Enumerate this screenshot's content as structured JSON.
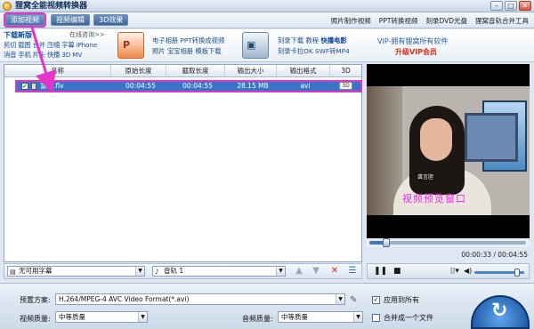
{
  "window": {
    "title": "狸窝全能视频转换器",
    "min": "–",
    "max": "□",
    "close": "✕"
  },
  "toolbar": {
    "add_video": "添加视频",
    "video_edit": "视频编辑",
    "effect_3d": "3D效果"
  },
  "top_links": [
    "照片制作视频",
    "PPT转换视频",
    "刻录DVD光盘",
    "狸窝音轨合并工具"
  ],
  "promo": {
    "download_title": "下载新版",
    "online_help": "在线咨询>>",
    "tools_line1": "剪切 截图 合并 压缩 字幕 iPhone",
    "tools_line2": "消音 手机 片头 快播 3D MV",
    "ppt_line1": "电子相册 PPT转换成视频",
    "ppt_line2": "照片 宝宝相册 模板下载",
    "burn_line1_prefix": "刻录下载 教程",
    "burn_line1_highlight": "快播电影",
    "burn_line2": "刻录卡拉OK SWF转MP4",
    "vip_line1": "VIP-拥有狸窝所有软件",
    "vip_line2": "升级VIP会员",
    "tile_ppt": "P",
    "tile_burn": "▣"
  },
  "table": {
    "columns": [
      "名称",
      "原始长度",
      "截取长度",
      "输出大小",
      "输出格式",
      "3D"
    ],
    "rows": [
      {
        "checked": "✓",
        "name": "富言.flv",
        "original": "00:04:55",
        "clip": "00:04:55",
        "size": "28.15 MB",
        "format": "avi",
        "threeD": "3D"
      }
    ]
  },
  "preview": {
    "watermark": "视频预览窗口",
    "caption": "龚言胆",
    "time": "00:00:33 / 00:04:55",
    "progress": 0.11,
    "volume": 0.85
  },
  "options": {
    "subtitle": "无可用字幕",
    "audio_track": "音轨 1"
  },
  "bottom": {
    "preset_label": "预置方案:",
    "preset_value": "H.264/MPEG-4 AVC Video Format(*.avi)",
    "video_quality_label": "视频质量:",
    "video_quality_value": "中等质量",
    "audio_quality_label": "音频质量:",
    "audio_quality_value": "中等质量",
    "apply_all": "应用到所有",
    "apply_all_checked": "✓",
    "merge": "合并成一个文件"
  },
  "colors": {
    "highlight": "#e136c7",
    "selected_row": "#3875c6",
    "accent": "#2c6bc2"
  }
}
